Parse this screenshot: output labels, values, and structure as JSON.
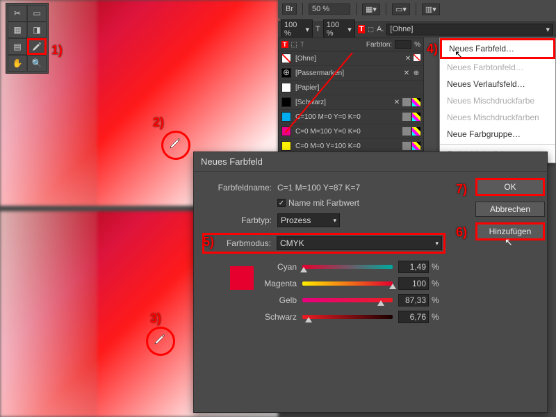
{
  "topbar": {
    "br": "Br",
    "zoom": "50 %"
  },
  "charbar": {
    "pct1": "100 %",
    "pct2": "100 %",
    "farbton_label": "Farbton:",
    "farbton_pct": "%",
    "charstyle_label": "[Ohne]",
    "T": "T"
  },
  "toolbox_tip": "1)",
  "swatches": {
    "items": [
      {
        "name": "[Ohne]",
        "fill": "none"
      },
      {
        "name": "[Passermarken]",
        "fill": "reg"
      },
      {
        "name": "[Papier]",
        "fill": "#ffffff"
      },
      {
        "name": "[Schwarz]",
        "fill": "#000000"
      },
      {
        "name": "C=100 M=0 Y=0 K=0",
        "fill": "#00aeef"
      },
      {
        "name": "C=0 M=100 Y=0 K=0",
        "fill": "#ec008c"
      },
      {
        "name": "C=0 M=0 Y=100 K=0",
        "fill": "#fff200"
      }
    ]
  },
  "context_menu": {
    "items": [
      "Neues Farbfeld…",
      "Neues Farbtonfeld…",
      "Neues Verlaufsfeld…",
      "Neues Mischdruckfarbe",
      "Neues Mischdruckfarben",
      "Neue Farbgruppe…",
      "Farbfeld duplizieren"
    ]
  },
  "dialog": {
    "title": "Neues Farbfeld",
    "name_label": "Farbfeldname:",
    "name_value": "C=1 M=100 Y=87 K=7",
    "name_with_value_label": "Name mit Farbwert",
    "farbtyp_label": "Farbtyp:",
    "farbtyp_value": "Prozess",
    "farbmodus_label": "Farbmodus:",
    "farbmodus_value": "CMYK",
    "cyan_label": "Cyan",
    "magenta_label": "Magenta",
    "gelb_label": "Gelb",
    "schwarz_label": "Schwarz",
    "cyan_val": "1,49",
    "magenta_val": "100",
    "gelb_val": "87,33",
    "schwarz_val": "6,76",
    "pct": "%",
    "ok": "OK",
    "cancel": "Abbrechen",
    "add": "Hinzufügen"
  },
  "steps": {
    "s1": "1)",
    "s2": "2)",
    "s3": "3)",
    "s4": "4)",
    "s5": "5)",
    "s6": "6)",
    "s7": "7)"
  }
}
